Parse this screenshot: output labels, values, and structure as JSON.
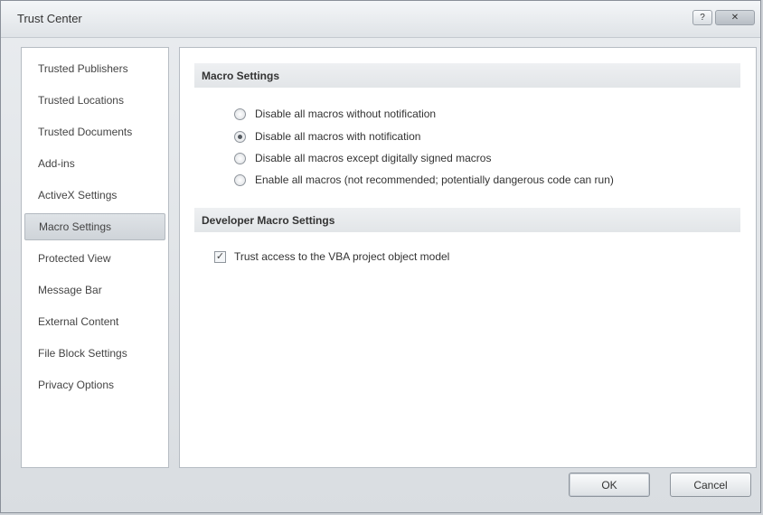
{
  "window": {
    "title": "Trust Center"
  },
  "titlebar": {
    "help_icon": "help-icon",
    "close_icon": "close-icon"
  },
  "sidebar": {
    "items": [
      {
        "label": "Trusted Publishers"
      },
      {
        "label": "Trusted Locations"
      },
      {
        "label": "Trusted Documents"
      },
      {
        "label": "Add-ins"
      },
      {
        "label": "ActiveX Settings"
      },
      {
        "label": "Macro Settings",
        "selected": true
      },
      {
        "label": "Protected View"
      },
      {
        "label": "Message Bar"
      },
      {
        "label": "External Content"
      },
      {
        "label": "File Block Settings"
      },
      {
        "label": "Privacy Options"
      }
    ]
  },
  "macro_settings": {
    "header": "Macro Settings",
    "options": [
      {
        "label": "Disable all macros without notification",
        "checked": false
      },
      {
        "label": "Disable all macros with notification",
        "checked": true
      },
      {
        "label": "Disable all macros except digitally signed macros",
        "checked": false
      },
      {
        "label": "Enable all macros (not recommended; potentially dangerous code can run)",
        "checked": false
      }
    ]
  },
  "developer_settings": {
    "header": "Developer Macro Settings",
    "trust_vba": {
      "label": "Trust access to the VBA project object model",
      "checked": true
    }
  },
  "buttons": {
    "ok": "OK",
    "cancel": "Cancel"
  }
}
